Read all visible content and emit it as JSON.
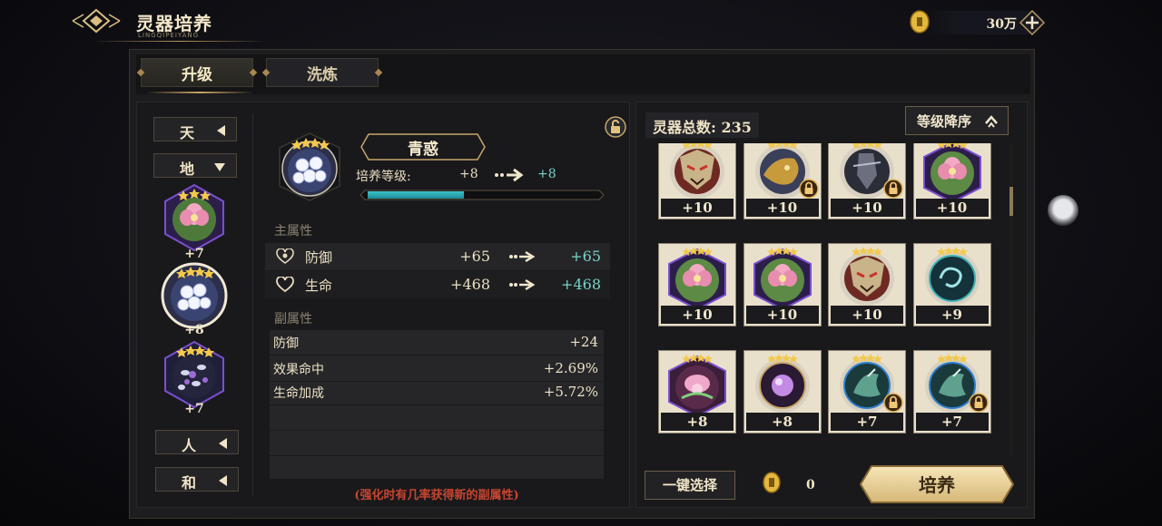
{
  "header": {
    "title": "灵器培养",
    "subtitle": "LINGQIPEIYANG",
    "currency_amount": "30万"
  },
  "tabs": [
    {
      "label": "升级",
      "active": true
    },
    {
      "label": "洗炼",
      "active": false
    }
  ],
  "grades": [
    {
      "label": "天",
      "icon": "triangle-left-icon"
    },
    {
      "label": "地",
      "icon": "triangle-down-icon"
    },
    {
      "label": "人",
      "icon": "triangle-left-icon"
    },
    {
      "label": "和",
      "icon": "triangle-left-icon"
    }
  ],
  "grade_items": [
    {
      "level": "+7",
      "art": "pink-lotus-art",
      "stars": 3
    },
    {
      "level": "+8",
      "art": "white-flower-art",
      "stars": 4,
      "selected": true
    },
    {
      "level": "+7",
      "art": "purple-petals-art",
      "stars": 4
    }
  ],
  "detail": {
    "name": "青惑",
    "level_label": "培养等级:",
    "level_from": "+8",
    "level_to": "+8",
    "progress": 0.41,
    "main_label": "主属性",
    "main_stats": [
      {
        "name": "防御",
        "from": "+65",
        "to": "+65",
        "icon": "shield-heart-icon"
      },
      {
        "name": "生命",
        "from": "+468",
        "to": "+468",
        "icon": "heart-icon"
      }
    ],
    "sub_label": "副属性",
    "sub_stats": [
      {
        "name": "防御",
        "value": "+24"
      },
      {
        "name": "效果命中",
        "value": "+2.69%"
      },
      {
        "name": "生命加成",
        "value": "+5.72%"
      }
    ],
    "hint": "(强化时有几率获得新的副属性)"
  },
  "inventory": {
    "total_label": "灵器总数: 235",
    "sort_label": "等级降序",
    "cards": [
      {
        "level": "+10",
        "art": "dragon-mask-art",
        "locked": false
      },
      {
        "level": "+10",
        "art": "golden-beast-art",
        "locked": true
      },
      {
        "level": "+10",
        "art": "dark-warrior-art",
        "locked": true
      },
      {
        "level": "+10",
        "art": "pink-lotus-art",
        "locked": false
      },
      {
        "level": "+10",
        "art": "pink-lotus-art",
        "locked": false
      },
      {
        "level": "+10",
        "art": "pink-lotus-art",
        "locked": false
      },
      {
        "level": "+10",
        "art": "dragon-mask-art",
        "locked": false
      },
      {
        "level": "+9",
        "art": "blue-swirl-art",
        "locked": false
      },
      {
        "level": "+8",
        "art": "pink-bloom-art",
        "locked": false
      },
      {
        "level": "+8",
        "art": "purple-orb-art",
        "locked": false
      },
      {
        "level": "+7",
        "art": "jade-crane-art",
        "locked": true
      },
      {
        "level": "+7",
        "art": "jade-crane-art",
        "locked": true
      }
    ]
  },
  "footer": {
    "select_label": "一键选择",
    "cost": "0",
    "cultivate_label": "培养"
  },
  "colors": {
    "accent_gold": "#c8a667",
    "stat_up": "#76d5c8",
    "hint_red": "#c8452f",
    "progress": "#39c2c9"
  }
}
